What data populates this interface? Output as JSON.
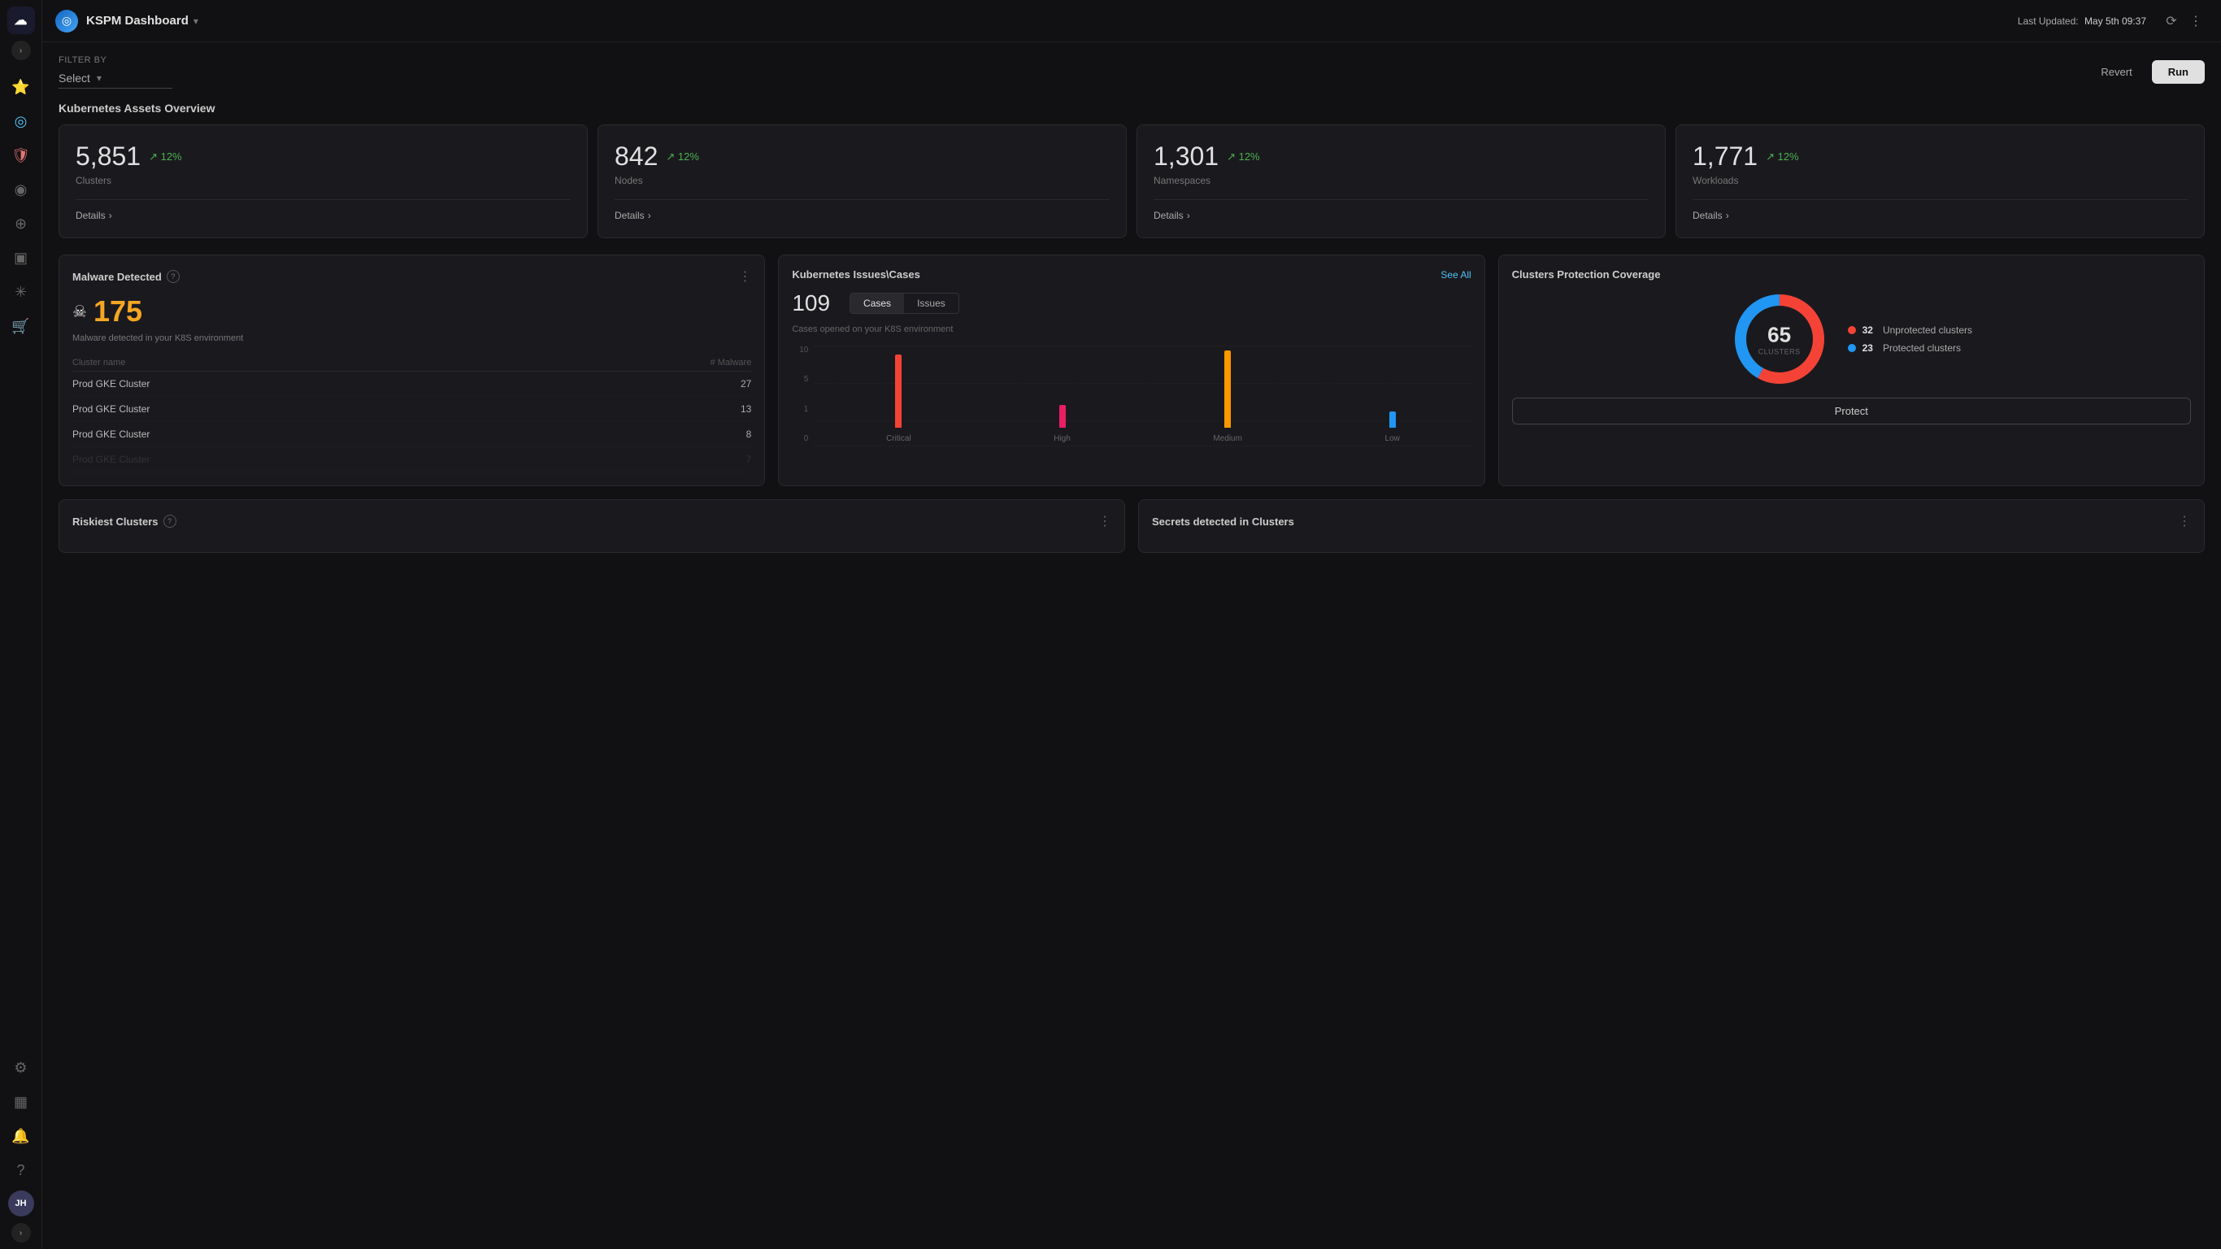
{
  "app": {
    "logo_letter": "☁",
    "title": "KSPM Dashboard",
    "last_updated_label": "Last Updated:",
    "last_updated_value": "May 5th 09:37",
    "revert_label": "Revert",
    "run_label": "Run",
    "user_initials": "JH"
  },
  "filter": {
    "label": "Filter by",
    "placeholder": "Select",
    "chevron": "▾"
  },
  "assets_overview": {
    "title": "Kubernetes Assets Overview",
    "cards": [
      {
        "value": "5,851",
        "pct": "↗ 12%",
        "label": "Clusters",
        "details": "Details"
      },
      {
        "value": "842",
        "pct": "↗ 12%",
        "label": "Nodes",
        "details": "Details"
      },
      {
        "value": "1,301",
        "pct": "↗ 12%",
        "label": "Namespaces",
        "details": "Details"
      },
      {
        "value": "1,771",
        "pct": "↗ 12%",
        "label": "Workloads",
        "details": "Details"
      }
    ]
  },
  "malware": {
    "title": "Malware Detected",
    "count": "175",
    "desc": "Malware detected in your K8S environment",
    "col_cluster": "Cluster name",
    "col_malware": "# Malware",
    "rows": [
      {
        "cluster": "Prod GKE Cluster",
        "count": "27"
      },
      {
        "cluster": "Prod GKE Cluster",
        "count": "13"
      },
      {
        "cluster": "Prod GKE Cluster",
        "count": "8"
      },
      {
        "cluster": "Prod GKE Cluster",
        "count": "7"
      }
    ]
  },
  "k8s_issues": {
    "title": "Kubernetes Issues\\Cases",
    "count": "109",
    "tabs": [
      "Cases",
      "Issues"
    ],
    "active_tab": 0,
    "see_all": "See All",
    "subtitle": "Cases opened on your K8S environment",
    "yaxis": [
      "10",
      "5",
      "1",
      "0"
    ],
    "bars": [
      {
        "label": "Critical",
        "height_pct": 85,
        "color": "#f44336"
      },
      {
        "label": "High",
        "height_pct": 25,
        "color": "#e91e63"
      },
      {
        "label": "Medium",
        "height_pct": 90,
        "color": "#ff9800"
      },
      {
        "label": "Low",
        "height_pct": 18,
        "color": "#2196f3"
      }
    ]
  },
  "protection": {
    "title": "Clusters Protection Coverage",
    "total": "65",
    "total_sub": "CLUSTERS",
    "unprotected_count": "32",
    "unprotected_label": "Unprotected clusters",
    "protected_count": "23",
    "protected_label": "Protected clusters",
    "protect_btn": "Protect",
    "unprotected_color": "#f44336",
    "protected_color": "#2196f3",
    "donut_bg_color": "#1a1a1e"
  },
  "riskiest": {
    "title": "Riskiest Clusters"
  },
  "secrets": {
    "title": "Secrets detected in Clusters"
  },
  "sidebar": {
    "icons": [
      "⭐",
      "◎",
      "🛡",
      "◉",
      "⊕",
      "▣",
      "✳",
      "🛒"
    ],
    "bottom_icons": [
      "⚙",
      "▦",
      "🔔",
      "?"
    ]
  }
}
